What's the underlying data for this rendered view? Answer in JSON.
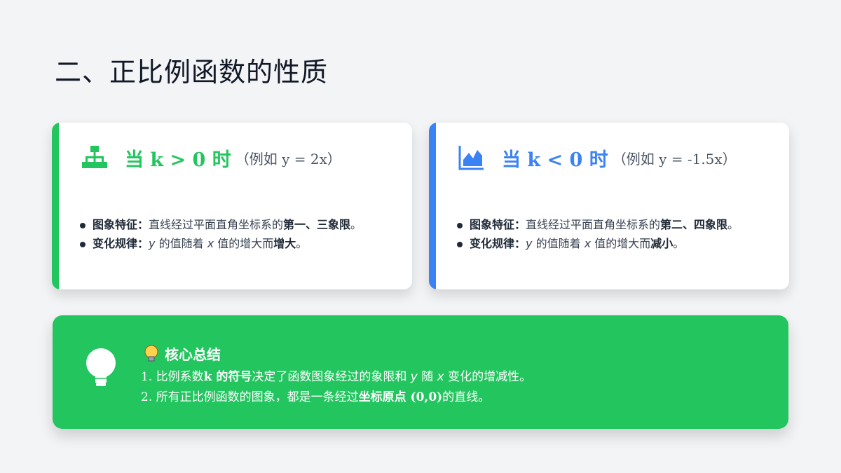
{
  "page": {
    "title": "二、正比例函数的性质"
  },
  "card_positive": {
    "heading": "当 k > 0 时",
    "note": "（例如 y = 2x）",
    "icon": "sitemap-icon",
    "accent": "#22c55e",
    "bullet1": {
      "label": "图象特征：",
      "text": "直线经过平面直角坐标系的",
      "bold": "第一、三象限",
      "end": "。"
    },
    "bullet2": {
      "label": "变化规律：",
      "var_y": "y",
      "text1": "的值随着",
      "var_x": "x",
      "text2": "值的增大而",
      "bold": "增大",
      "end": "。"
    }
  },
  "card_negative": {
    "heading": "当 k < 0 时",
    "note": "（例如 y = -1.5x）",
    "icon": "area-chart-icon",
    "accent": "#3b82f6",
    "bullet1": {
      "label": "图象特征：",
      "text": "直线经过平面直角坐标系的",
      "bold": "第二、四象限",
      "end": "。"
    },
    "bullet2": {
      "label": "变化规律：",
      "var_y": "y",
      "text1": "的值随着",
      "var_x": "x",
      "text2": "值的增大而",
      "bold": "减小",
      "end": "。"
    }
  },
  "summary": {
    "title": "核心总结",
    "icon": "lightbulb-icon",
    "line1": {
      "num": "1.",
      "pre": "比例系数",
      "bold": "k 的符号",
      "mid": "决定了函数图象经过的象限和",
      "var_y": "y",
      "text1": "随",
      "var_x": "x",
      "end": "变化的增减性。"
    },
    "line2": {
      "num": "2.",
      "pre": "所有正比例函数的图象，都是一条经过",
      "bold": "坐标原点 (0,0)",
      "end": "的直线。"
    }
  }
}
